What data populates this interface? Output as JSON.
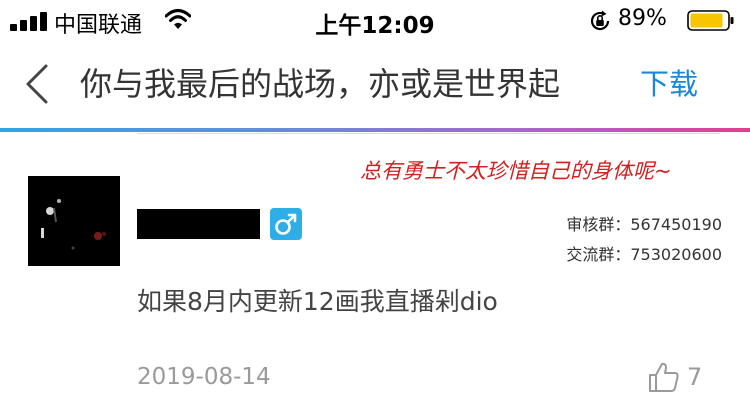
{
  "statusbar": {
    "carrier": "中国联通",
    "time": "上午12:09",
    "battery_percent": "89%",
    "battery_level": 0.89,
    "icons": [
      "signal-icon",
      "wifi-icon",
      "orientation-lock-icon",
      "battery-icon"
    ]
  },
  "navbar": {
    "title": "你与我最后的战场，亦或是世界起",
    "download_label": "下载",
    "back_icon": "chevron-left-icon"
  },
  "post": {
    "slogan": "总有勇士不太珍惜自己的身体呢~",
    "review_group": "审核群：567450190",
    "chat_group": "交流群：753020600",
    "content": "如果8月内更新12画我直播剁dio",
    "date": "2019-08-14",
    "likes": "7"
  },
  "colors": {
    "accent": "#1a88d6",
    "slogan": "#d12020",
    "gender_badge": "#2daee6",
    "battery": "#f7c600"
  }
}
